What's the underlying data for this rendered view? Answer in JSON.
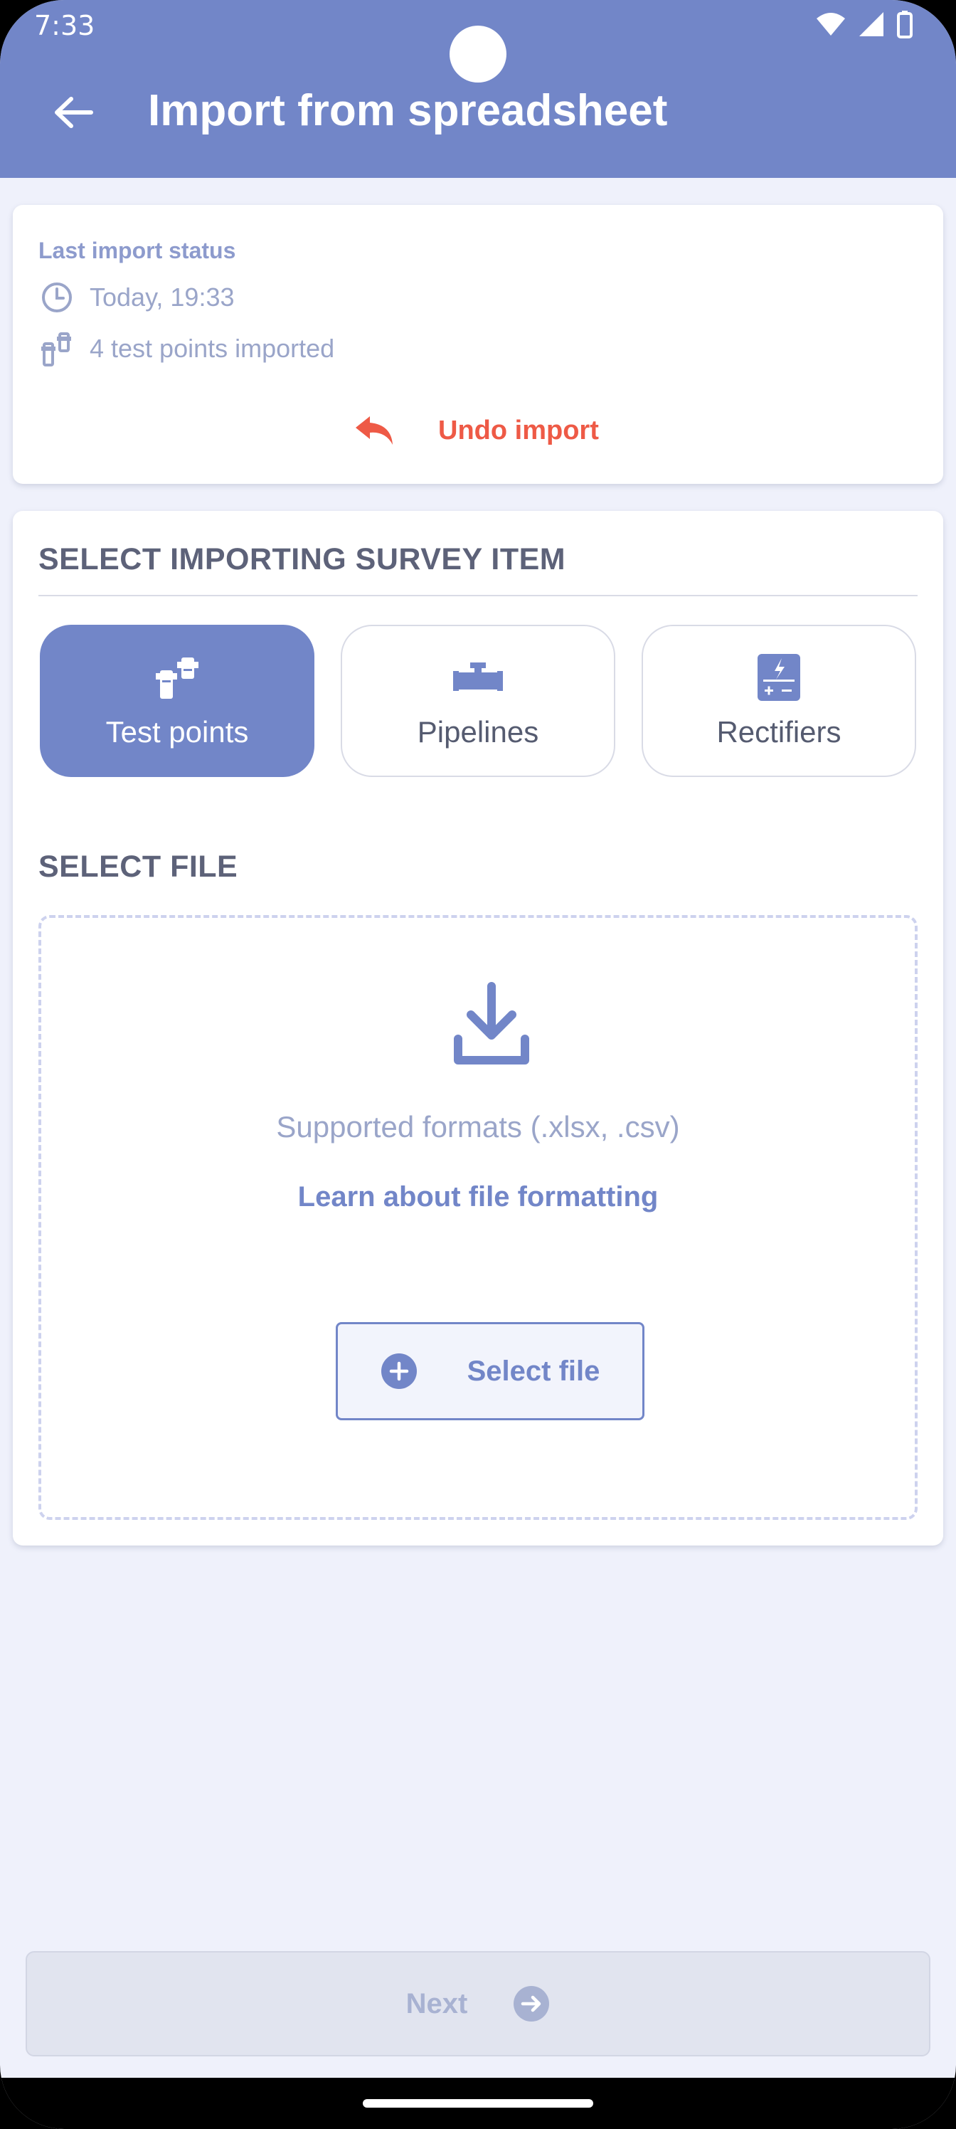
{
  "status_bar": {
    "time": "7:33"
  },
  "header": {
    "title": "Import from spreadsheet",
    "back_icon": "arrow-left-icon"
  },
  "last_import": {
    "heading": "Last import status",
    "time": "Today, 19:33",
    "count": "4 test points imported",
    "undo_label": "Undo import"
  },
  "survey_item": {
    "title": "SELECT IMPORTING SURVEY ITEM",
    "items": [
      {
        "label": "Test points",
        "icon": "test-point-icon",
        "selected": true
      },
      {
        "label": "Pipelines",
        "icon": "pipeline-icon",
        "selected": false
      },
      {
        "label": "Rectifiers",
        "icon": "rectifier-icon",
        "selected": false
      }
    ]
  },
  "file": {
    "title": "SELECT FILE",
    "formats": "Supported formats (.xlsx, .csv)",
    "learn_link": "Learn about file formatting",
    "select_label": "Select file"
  },
  "footer": {
    "next_label": "Next"
  },
  "colors": {
    "primary": "#7286c8",
    "accent_undo": "#ee5a46",
    "background": "#eff1fb"
  }
}
